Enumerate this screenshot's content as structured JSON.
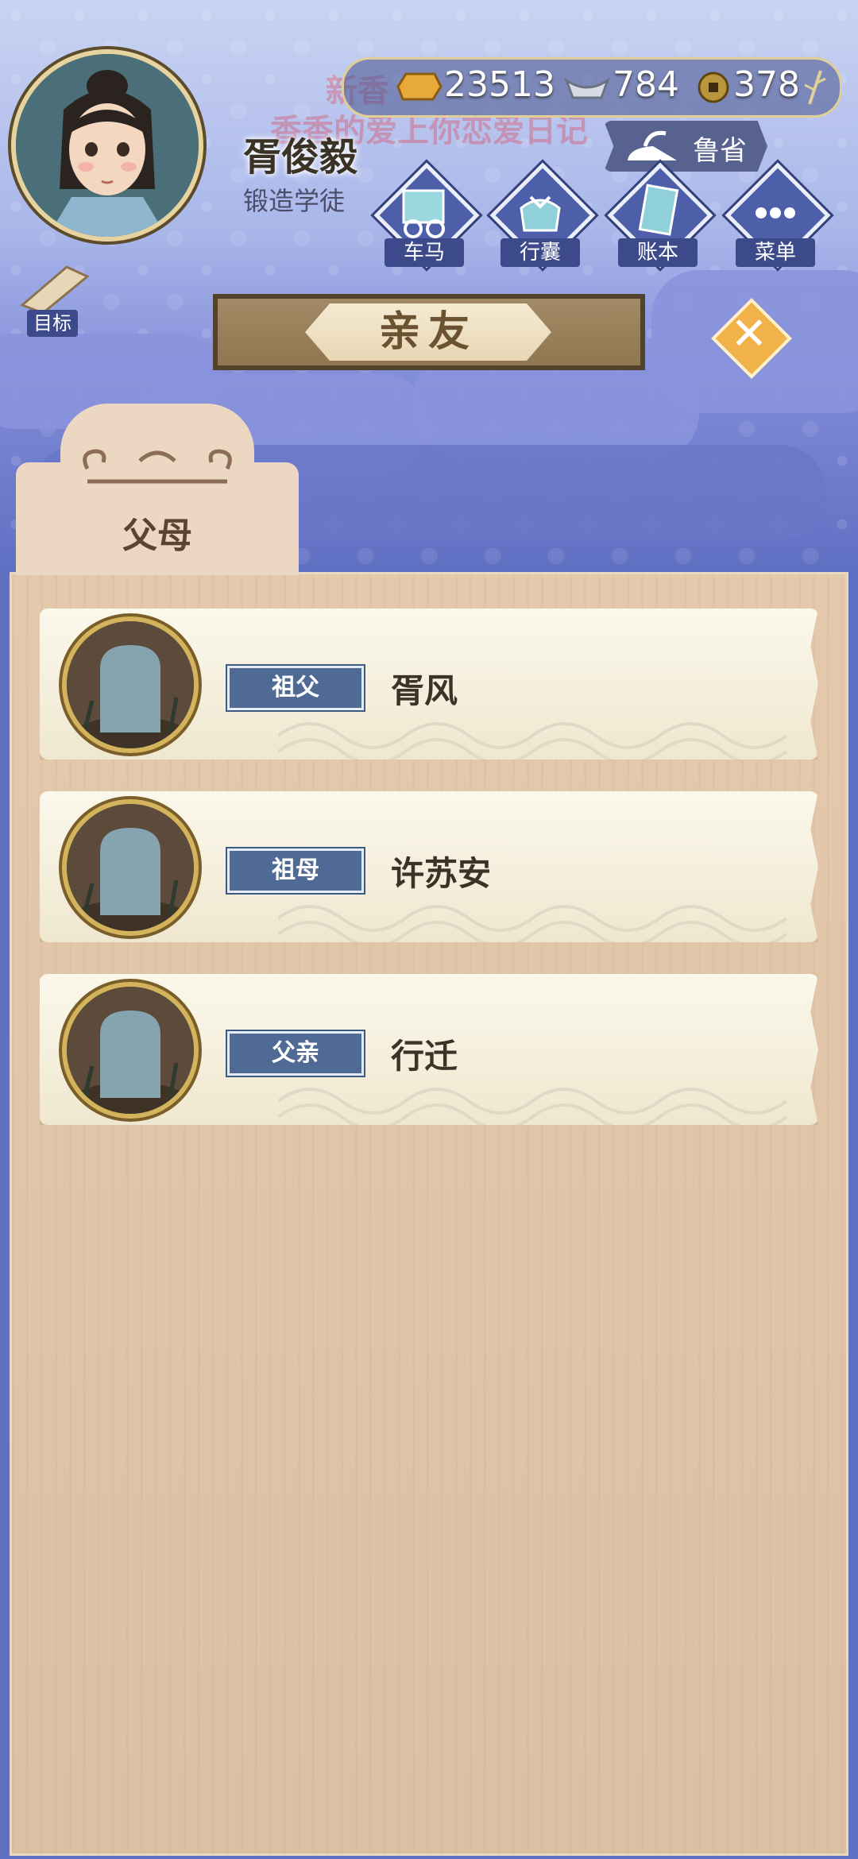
{
  "player": {
    "name": "胥俊毅",
    "job": "锻造学徒"
  },
  "currency": {
    "gold": "23513",
    "silver": "784",
    "coin": "378"
  },
  "region": "鲁省",
  "watermark": {
    "line1": "新香",
    "line2": "香香的爱上你恋爱日记"
  },
  "menu": [
    {
      "label": "车马",
      "icon": "carriage-icon"
    },
    {
      "label": "行囊",
      "icon": "bundle-icon"
    },
    {
      "label": "账本",
      "icon": "ledger-icon"
    },
    {
      "label": "菜单",
      "icon": "more-icon"
    }
  ],
  "target_label": "目标",
  "banner_title": "亲友",
  "tab_label": "父母",
  "relatives": [
    {
      "relation": "祖父",
      "name": "胥风"
    },
    {
      "relation": "祖母",
      "name": "许苏安"
    },
    {
      "relation": "父亲",
      "name": "行迁"
    }
  ],
  "colors": {
    "accent_gold": "#e1cf98",
    "relation_badge": "#4f6b95",
    "close_button": "#f2b24a"
  }
}
